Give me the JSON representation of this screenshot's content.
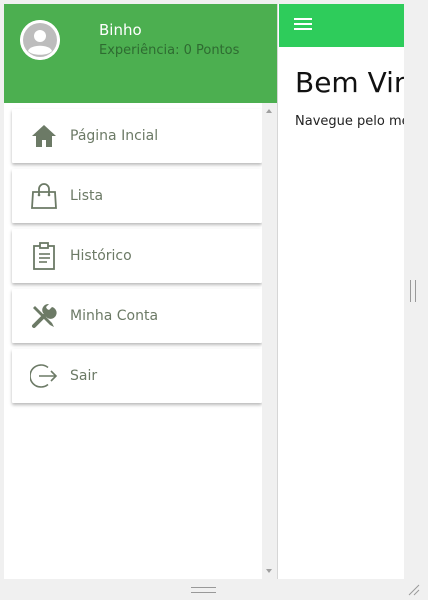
{
  "drawer": {
    "user_name": "Binho",
    "user_subtitle": "Experiência: 0 Pontos",
    "items": [
      {
        "label": "Página Incial",
        "icon": "home-icon"
      },
      {
        "label": "Lista",
        "icon": "shopping-bag-icon"
      },
      {
        "label": "Histórico",
        "icon": "clipboard-icon"
      },
      {
        "label": "Minha Conta",
        "icon": "tools-icon"
      },
      {
        "label": "Sair",
        "icon": "logout-icon"
      }
    ]
  },
  "main": {
    "title": "Bem Vin",
    "subtitle": "Navegue pelo me"
  },
  "colors": {
    "drawer_header": "#4caf50",
    "toolbar": "#2ecc5b",
    "icon": "#6c7a66"
  }
}
